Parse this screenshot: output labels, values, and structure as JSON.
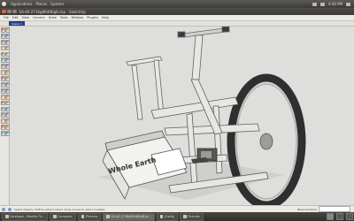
{
  "top_panel": {
    "menus": [
      "Applications",
      "Places",
      "System"
    ],
    "clock": "4:40 PM"
  },
  "window": {
    "title": "SA-40-27-BigWhltBigB.skp - SketchUp"
  },
  "menu_bar": [
    "File",
    "Edit",
    "View",
    "Camera",
    "Draw",
    "Tools",
    "Window",
    "Plugins",
    "Help"
  ],
  "scene_tab": "Scene 1",
  "tool_palette": [
    "select-icon",
    "component-icon",
    "paint-bucket-icon",
    "eraser-icon",
    "rectangle-icon",
    "line-icon",
    "circle-icon",
    "arc-icon",
    "polygon-icon",
    "freehand-icon",
    "move-icon",
    "push-pull-icon",
    "rotate-icon",
    "follow-me-icon",
    "scale-icon",
    "offset-icon",
    "tape-measure-icon",
    "dimension-icon",
    "protractor-icon",
    "text-icon",
    "axes-icon",
    "3d-text-icon",
    "orbit-icon",
    "pan-icon",
    "zoom-icon",
    "zoom-window-icon",
    "zoom-extents-icon",
    "previous-view-icon",
    "position-camera-icon",
    "walk-icon",
    "look-around-icon",
    "section-plane-icon",
    "sandbox-icon",
    "smoove-icon",
    "stamp-icon",
    "drape-icon"
  ],
  "status_bar": {
    "hint": "Select objects. Shift to extend select. Drag mouse to select multiple.",
    "measurements_label": "Measurements"
  },
  "taskbar": {
    "items": [
      {
        "label": "Facebook - Mozilla Fir...",
        "active": false
      },
      {
        "label": "Computer",
        "active": false
      },
      {
        "label": "Pictures",
        "active": false
      },
      {
        "label": "SA-40-27-BigWhltBigB.sk...",
        "active": true
      },
      {
        "label": "[Hello]",
        "active": false
      },
      {
        "label": "Pictures",
        "active": false
      }
    ]
  },
  "model": {
    "crate_text": "Whole Earth"
  },
  "colors": {
    "panel": "#3c3b37",
    "title_close": "#e0663a",
    "scene_tab": "#1f3d8c",
    "viewport": "#dededd",
    "tire": "#2f2f2f"
  }
}
